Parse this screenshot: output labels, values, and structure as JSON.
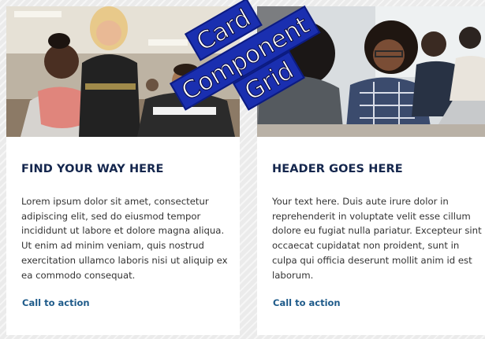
{
  "cards": [
    {
      "title": "FIND YOUR WAY HERE",
      "body": "Lorem ipsum dolor sit amet, consectetur adipiscing elit, sed do eiusmod tempor incididunt ut labore et dolore magna aliqua. Ut enim ad minim veniam, quis nostrud exercitation ullamco laboris nisi ut aliquip ex ea commodo consequat.",
      "cta": "Call to action"
    },
    {
      "title": "HEADER GOES HERE",
      "body": "Your text here. Duis aute irure dolor in reprehenderit in voluptate velit esse cillum dolore eu fugiat nulla pariatur. Excepteur sint occaecat cupidatat non proident, sunt in culpa qui officia deserunt mollit anim id est laborum.",
      "cta": "Call to action"
    }
  ],
  "overlay_label": [
    "Card",
    "Component",
    "Grid"
  ],
  "colors": {
    "title": "#14264d",
    "cta": "#1f5b8a",
    "body": "#333333",
    "overlay": "#1a2fb0",
    "background": "#ebebeb"
  }
}
